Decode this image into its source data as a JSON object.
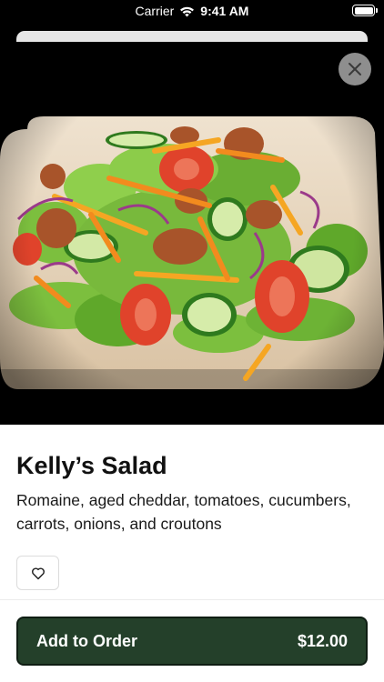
{
  "status_bar": {
    "carrier": "Carrier",
    "time": "9:41 AM"
  },
  "item": {
    "title": "Kelly’s Salad",
    "description": "Romaine, aged cheddar, tomatoes, cucumbers, carrots, onions, and croutons"
  },
  "order_button": {
    "label": "Add to Order",
    "price": "$12.00"
  },
  "icons": {
    "close": "close-icon",
    "favorite": "heart-icon",
    "wifi": "wifi-icon",
    "battery": "battery-icon"
  },
  "colors": {
    "button_bg": "#24402a",
    "hero_bg": "#000000",
    "close_bg": "#8e8e8e"
  }
}
